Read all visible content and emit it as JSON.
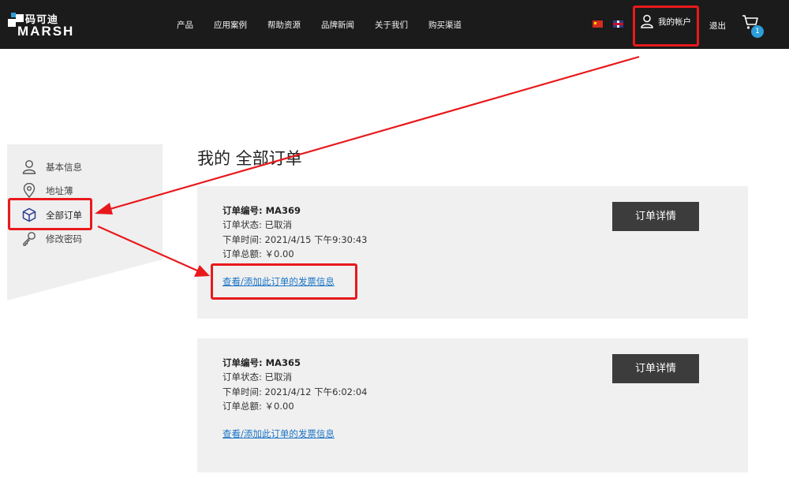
{
  "header": {
    "logo_cn": "码可迪",
    "logo_en": "MARSH",
    "nav": [
      "产品",
      "应用案例",
      "帮助资源",
      "品牌新闻",
      "关于我们",
      "购买渠道"
    ],
    "account_label": "我的帐户",
    "logout_label": "退出",
    "cart_count": "1",
    "flag_icons": [
      "china-flag-icon",
      "uk-flag-icon"
    ]
  },
  "sidebar": {
    "items": [
      {
        "label": "基本信息",
        "icon": "user-icon"
      },
      {
        "label": "地址薄",
        "icon": "location-pin-icon"
      },
      {
        "label": "全部订单",
        "icon": "box-icon"
      },
      {
        "label": "修改密码",
        "icon": "key-icon"
      }
    ]
  },
  "main": {
    "title": "我的 全部订单",
    "orders": [
      {
        "number_line": "订单编号: MA369",
        "status_line": "订单状态: 已取消",
        "time_line": "下单时间: 2021/4/15 下午9:30:43",
        "total_line": "订单总额: ￥0.00",
        "invoice_link": "查看/添加此订单的发票信息",
        "detail_button": "订单详情"
      },
      {
        "number_line": "订单编号: MA365",
        "status_line": "订单状态: 已取消",
        "time_line": "下单时间: 2021/4/12 下午6:02:04",
        "total_line": "订单总额: ￥0.00",
        "invoice_link": "查看/添加此订单的发票信息",
        "detail_button": "订单详情"
      }
    ]
  },
  "colors": {
    "header_bg": "#1b1b1b",
    "accent_red": "#e8191c",
    "link_blue": "#1a73c4",
    "button_dark": "#3c3c3c",
    "cart_badge": "#2c9ed9",
    "card_bg": "#f0f0f0"
  }
}
